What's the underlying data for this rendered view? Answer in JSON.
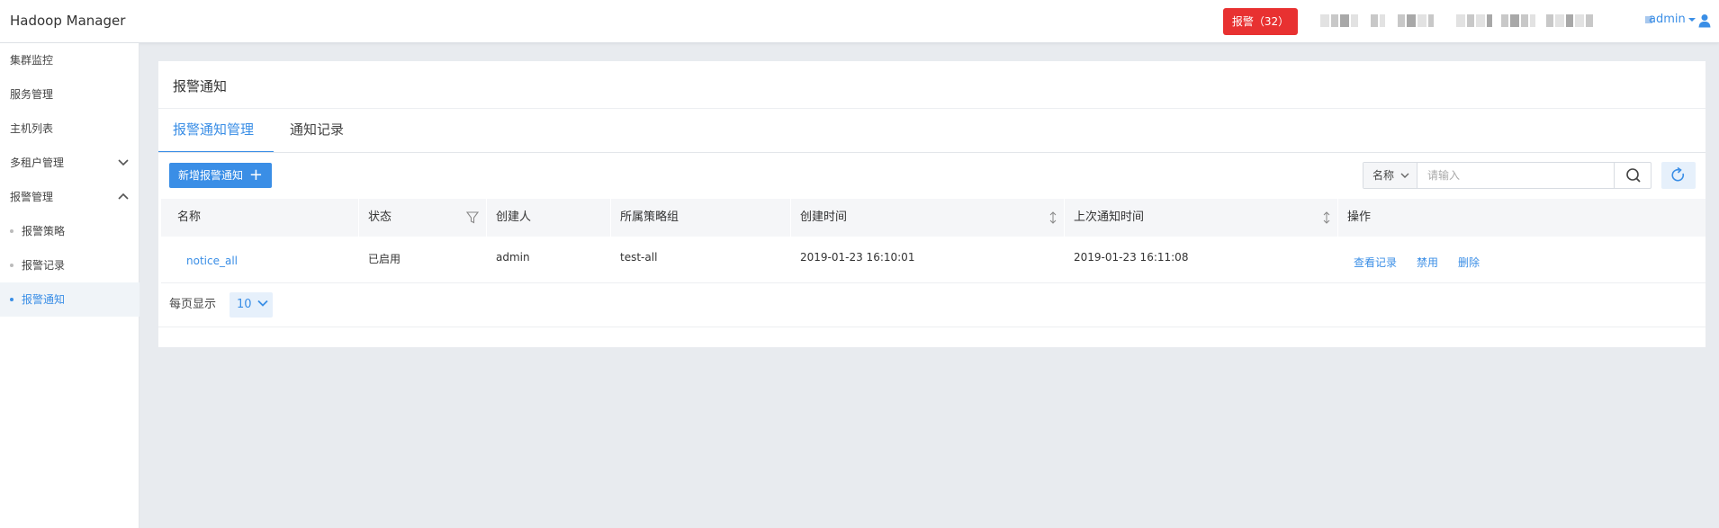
{
  "app": {
    "title": "Hadoop Manager"
  },
  "header": {
    "alarm_label": "报警（32）",
    "user_label": "admin"
  },
  "sidebar": {
    "items": [
      {
        "label": "集群监控"
      },
      {
        "label": "服务管理"
      },
      {
        "label": "主机列表"
      },
      {
        "label": "多租户管理"
      },
      {
        "label": "报警管理"
      },
      {
        "label": "报警策略"
      },
      {
        "label": "报警记录"
      },
      {
        "label": "报警通知"
      }
    ]
  },
  "main": {
    "title": "报警通知",
    "tabs": [
      {
        "label": "报警通知管理"
      },
      {
        "label": "通知记录"
      }
    ],
    "add_button_label": "新增报警通知",
    "search": {
      "field_label": "名称",
      "placeholder": "请输入",
      "value": ""
    },
    "table": {
      "columns": [
        "名称",
        "状态",
        "创建人",
        "所属策略组",
        "创建时间",
        "上次通知时间",
        "操作"
      ],
      "rows": [
        {
          "name": "notice_all",
          "status": "已启用",
          "creator": "admin",
          "policy_group": "test-all",
          "created": "2019-01-23 16:10:01",
          "last_notified": "2019-01-23 16:11:08",
          "actions": [
            "查看记录",
            "禁用",
            "删除"
          ]
        }
      ]
    },
    "pagination": {
      "per_page_label": "每页显示",
      "per_page_value": "10"
    }
  },
  "colors": {
    "accent": "#3a8ee6",
    "alarm": "#e83131",
    "background": "#e8ebef"
  }
}
